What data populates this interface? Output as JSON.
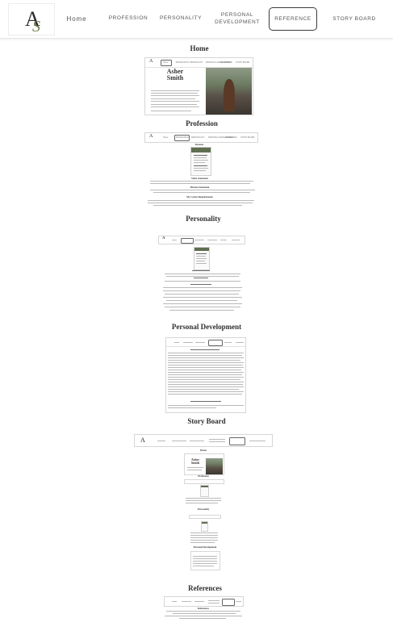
{
  "nav": {
    "logo_alt": "AS",
    "home": "Home",
    "profession": "PROFESSION",
    "personality": "PERSONALITY",
    "personal_dev_1": "PERSONAL",
    "personal_dev_2": "DEVELOPMENT",
    "reference": "REFERENCE",
    "story_board": "STORY BOARD"
  },
  "sections": {
    "home": "Home",
    "profession": "Profession",
    "personality": "Personality",
    "personal_development": "Personal Development",
    "story_board": "Story Board",
    "references": "References"
  },
  "home_preview": {
    "name_first": "Asher",
    "name_last": "Smith"
  },
  "mini_nav": {
    "home": "Home",
    "profession": "PROFESSION",
    "personality": "PERSONALITY",
    "personal_development": "PERSONAL DEVELOPMENT",
    "reference": "REFERENCE",
    "story_board": "STORY BOARD"
  },
  "profession_preview": {
    "resume": "Resume",
    "value_statement": "Value Statement",
    "mission_statement": "Mission Statement",
    "career_requirements": "My Career Requirements"
  },
  "storyboard_preview": {
    "home": "Home",
    "profession": "Profession",
    "personality": "Personality",
    "personal_development": "Personal Development"
  },
  "references_preview": {
    "title": "References"
  },
  "colors": {
    "accent_green": "#5f6e50",
    "border": "#3b3b3b"
  }
}
